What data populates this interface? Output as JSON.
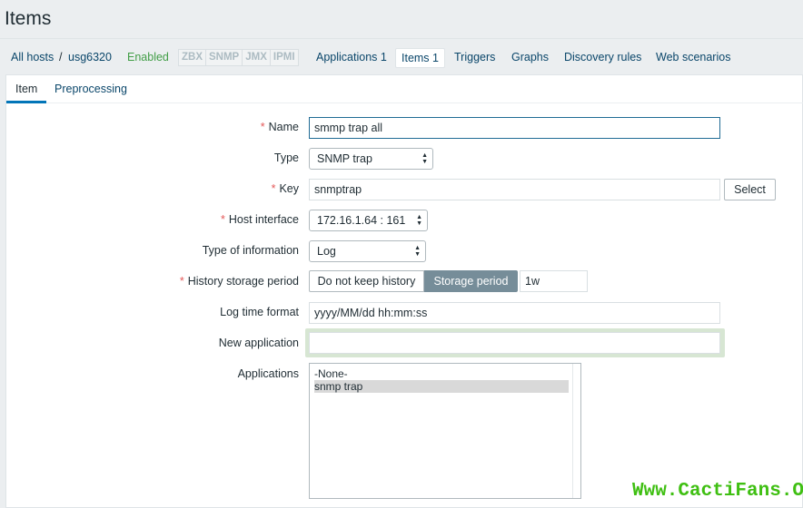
{
  "page": {
    "title": "Items"
  },
  "host_nav": {
    "all_hosts": "All hosts",
    "separator": "/",
    "host": "usg6320",
    "status": "Enabled",
    "protocols": [
      "ZBX",
      "SNMP",
      "JMX",
      "IPMI"
    ],
    "applications": "Applications 1",
    "items": "Items 1",
    "triggers": "Triggers",
    "graphs": "Graphs",
    "discovery_rules": "Discovery rules",
    "web_scenarios": "Web scenarios"
  },
  "tabs": {
    "item": "Item",
    "preprocessing": "Preprocessing"
  },
  "form": {
    "required_mark": "*",
    "name_label": "Name",
    "name_value": "smmp trap all",
    "type_label": "Type",
    "type_value": "SNMP trap",
    "key_label": "Key",
    "key_value": "snmptrap",
    "select_button": "Select",
    "host_interface_label": "Host interface",
    "host_interface_value": "172.16.1.64 : 161",
    "type_info_label": "Type of information",
    "type_info_value": "Log",
    "history_label": "History storage period",
    "history_off": "Do not keep history",
    "history_on": "Storage period",
    "history_value": "1w",
    "log_time_label": "Log time format",
    "log_time_value": "yyyy/MM/dd hh:mm:ss",
    "new_app_label": "New application",
    "new_app_value": "",
    "applications_label": "Applications",
    "applications_options": [
      "-None-",
      "snmp trap"
    ]
  },
  "watermark": "Www.CactiFans.Org",
  "colors": {
    "link": "#0a466a",
    "enabled": "#429e47",
    "required": "#e45959",
    "tab_active": "#0275b8",
    "seg_active": "#768d99",
    "watermark": "#3fbf12"
  }
}
